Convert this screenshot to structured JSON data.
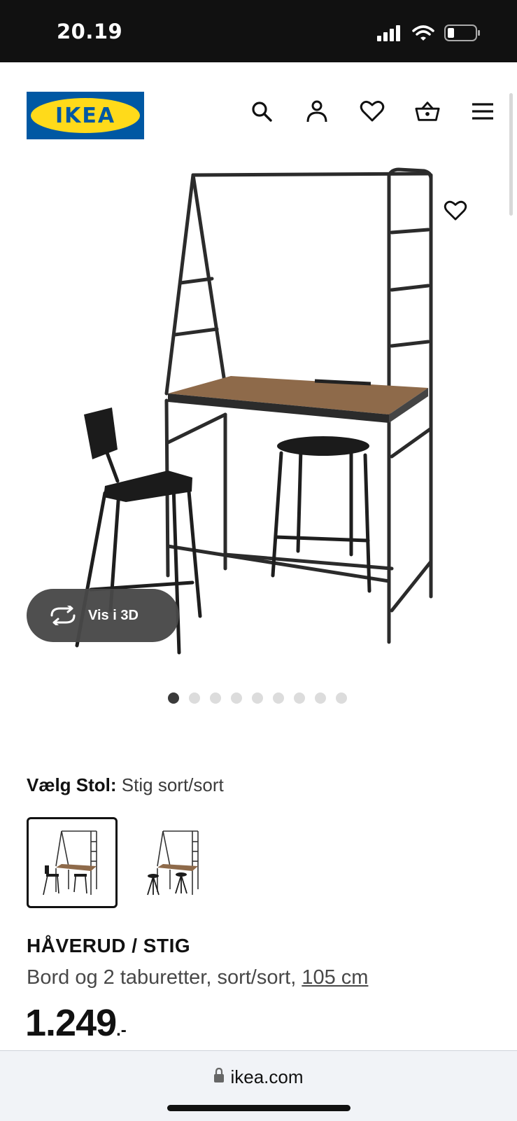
{
  "status_bar": {
    "time": "20.19",
    "icons": [
      "signal-icon",
      "wifi-icon",
      "battery-icon"
    ]
  },
  "header": {
    "logo_text": "IKEA",
    "icons": [
      "search-icon",
      "account-icon",
      "heart-icon",
      "basket-icon",
      "menu-icon"
    ]
  },
  "gallery": {
    "vis3d_label": "Vis i 3D",
    "dot_count": 9,
    "active_dot": 1
  },
  "options": {
    "label": "Vælg Stol:",
    "value": "Stig sort/sort",
    "variants": [
      "variant-stig",
      "variant-stool"
    ]
  },
  "product": {
    "name": "HÅVERUD / STIG",
    "description": "Bord og 2 taburetter, sort/sort, ",
    "size_link": "105 cm",
    "price": "1.249",
    "price_suffix": ".-"
  },
  "browser": {
    "url": "ikea.com"
  },
  "colors": {
    "ikea_blue": "#0058a3",
    "ikea_yellow": "#ffda1a",
    "status_bar": "#111111",
    "wood": "#8e6a4a"
  }
}
